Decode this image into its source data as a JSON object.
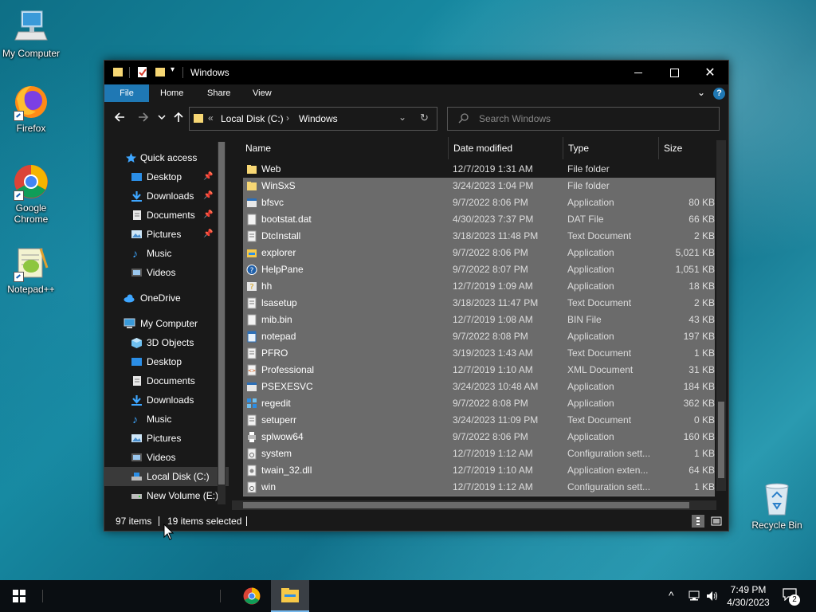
{
  "desktop": {
    "icons": [
      {
        "label": "My Computer"
      },
      {
        "label": "Firefox"
      },
      {
        "label": "Google Chrome"
      },
      {
        "label": "Notepad++"
      },
      {
        "label": "Recycle Bin"
      }
    ]
  },
  "window": {
    "title": "Windows",
    "ribbon_tabs": [
      "File",
      "Home",
      "Share",
      "View"
    ],
    "address": {
      "prefix": "«",
      "crumbs": [
        "Local Disk (C:)",
        "Windows"
      ]
    },
    "search_placeholder": "Search Windows",
    "columns": [
      "Name",
      "Date modified",
      "Type",
      "Size"
    ],
    "nav": {
      "quick_access": "Quick access",
      "quick_items": [
        "Desktop",
        "Downloads",
        "Documents",
        "Pictures",
        "Music",
        "Videos"
      ],
      "onedrive": "OneDrive",
      "my_computer": "My Computer",
      "pc_items": [
        "3D Objects",
        "Desktop",
        "Documents",
        "Downloads",
        "Music",
        "Pictures",
        "Videos",
        "Local Disk (C:)",
        "New Volume (E:)"
      ]
    },
    "files": [
      {
        "name": "Web",
        "date": "12/7/2019 1:31 AM",
        "type": "File folder",
        "size": "",
        "selected": false,
        "icon": "folder-icon"
      },
      {
        "name": "WinSxS",
        "date": "3/24/2023 1:04 PM",
        "type": "File folder",
        "size": "",
        "selected": true,
        "icon": "folder-icon"
      },
      {
        "name": "bfsvc",
        "date": "9/7/2022 8:06 PM",
        "type": "Application",
        "size": "80 KB",
        "selected": true,
        "icon": "app-icon"
      },
      {
        "name": "bootstat.dat",
        "date": "4/30/2023 7:37 PM",
        "type": "DAT File",
        "size": "66 KB",
        "selected": true,
        "icon": "file-icon"
      },
      {
        "name": "DtcInstall",
        "date": "3/18/2023 11:48 PM",
        "type": "Text Document",
        "size": "2 KB",
        "selected": true,
        "icon": "text-file-icon"
      },
      {
        "name": "explorer",
        "date": "9/7/2022 8:06 PM",
        "type": "Application",
        "size": "5,021 KB",
        "selected": true,
        "icon": "explorer-icon"
      },
      {
        "name": "HelpPane",
        "date": "9/7/2022 8:07 PM",
        "type": "Application",
        "size": "1,051 KB",
        "selected": true,
        "icon": "help-icon"
      },
      {
        "name": "hh",
        "date": "12/7/2019 1:09 AM",
        "type": "Application",
        "size": "18 KB",
        "selected": true,
        "icon": "help-app-icon"
      },
      {
        "name": "lsasetup",
        "date": "3/18/2023 11:47 PM",
        "type": "Text Document",
        "size": "2 KB",
        "selected": true,
        "icon": "text-file-icon"
      },
      {
        "name": "mib.bin",
        "date": "12/7/2019 1:08 AM",
        "type": "BIN File",
        "size": "43 KB",
        "selected": true,
        "icon": "file-icon"
      },
      {
        "name": "notepad",
        "date": "9/7/2022 8:08 PM",
        "type": "Application",
        "size": "197 KB",
        "selected": true,
        "icon": "notepad-icon"
      },
      {
        "name": "PFRO",
        "date": "3/19/2023 1:43 AM",
        "type": "Text Document",
        "size": "1 KB",
        "selected": true,
        "icon": "text-file-icon"
      },
      {
        "name": "Professional",
        "date": "12/7/2019 1:10 AM",
        "type": "XML Document",
        "size": "31 KB",
        "selected": true,
        "icon": "xml-file-icon"
      },
      {
        "name": "PSEXESVC",
        "date": "3/24/2023 10:48 AM",
        "type": "Application",
        "size": "184 KB",
        "selected": true,
        "icon": "app-icon"
      },
      {
        "name": "regedit",
        "date": "9/7/2022 8:08 PM",
        "type": "Application",
        "size": "362 KB",
        "selected": true,
        "icon": "regedit-icon"
      },
      {
        "name": "setuperr",
        "date": "3/24/2023 11:09 PM",
        "type": "Text Document",
        "size": "0 KB",
        "selected": true,
        "icon": "text-file-icon"
      },
      {
        "name": "splwow64",
        "date": "9/7/2022 8:06 PM",
        "type": "Application",
        "size": "160 KB",
        "selected": true,
        "icon": "printer-app-icon"
      },
      {
        "name": "system",
        "date": "12/7/2019 1:12 AM",
        "type": "Configuration sett...",
        "size": "1 KB",
        "selected": true,
        "icon": "config-file-icon"
      },
      {
        "name": "twain_32.dll",
        "date": "12/7/2019 1:10 AM",
        "type": "Application exten...",
        "size": "64 KB",
        "selected": true,
        "icon": "dll-file-icon"
      },
      {
        "name": "win",
        "date": "12/7/2019 1:12 AM",
        "type": "Configuration sett...",
        "size": "1 KB",
        "selected": true,
        "icon": "config-file-icon"
      }
    ],
    "status": {
      "count": "97 items",
      "selected": "19 items selected"
    }
  },
  "taskbar": {
    "time": "7:49 PM",
    "date": "4/30/2023",
    "notification_count": "2"
  },
  "colors": {
    "accent": "#1f78b4",
    "selection": "#6b6b6b",
    "window_bg": "#191919"
  }
}
